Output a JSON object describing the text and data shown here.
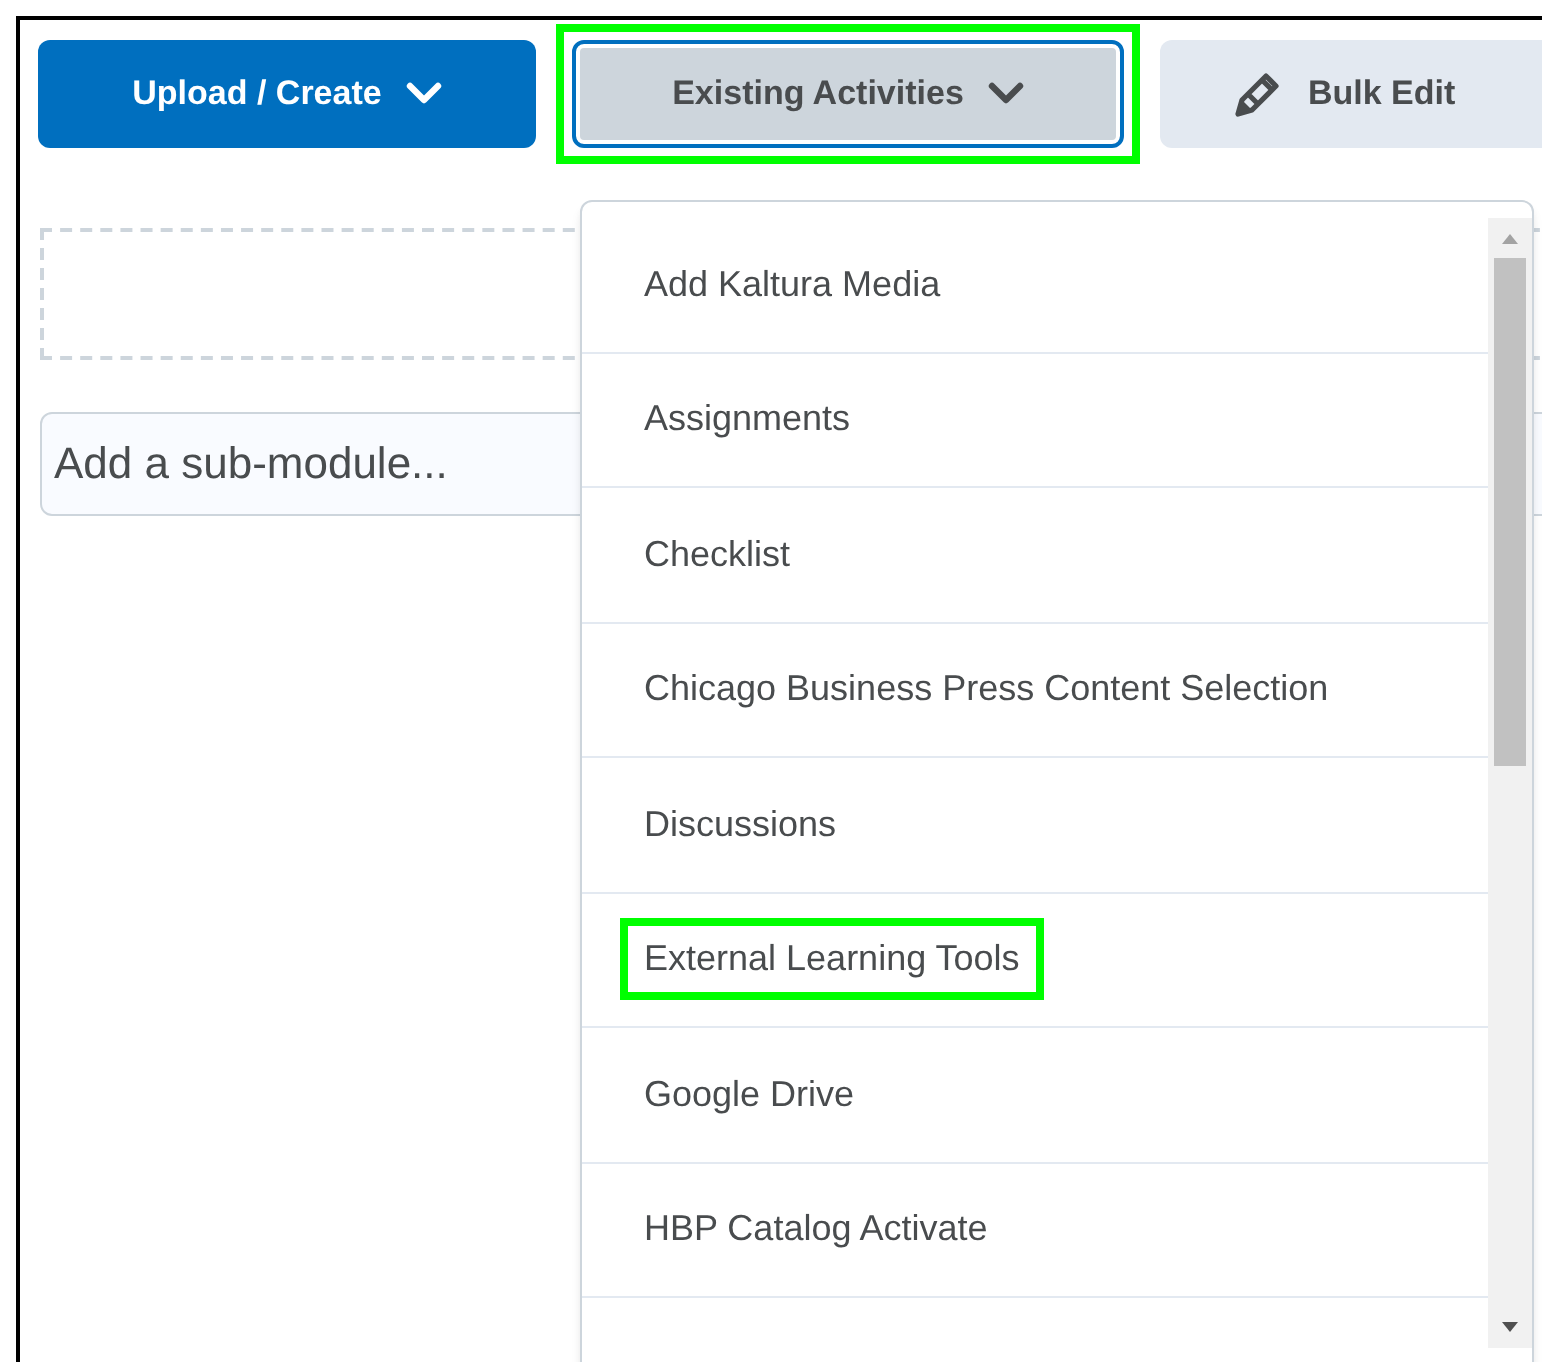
{
  "toolbar": [
    {
      "kind": "primary",
      "label": "Upload / Create",
      "expanded": false,
      "highlighted": false
    },
    {
      "kind": "dropdown",
      "label": "Existing Activities",
      "expanded": true,
      "highlighted": true
    },
    {
      "kind": "edit",
      "label": "Bulk Edit",
      "expanded": false,
      "highlighted": false
    }
  ],
  "submodule": {
    "placeholder": "Add a sub-module..."
  },
  "menu": {
    "items": [
      {
        "label": "Add Kaltura Media",
        "highlighted": false
      },
      {
        "label": "Assignments",
        "highlighted": false
      },
      {
        "label": "Checklist",
        "highlighted": false
      },
      {
        "label": "Chicago Business Press Content Selection",
        "highlighted": false
      },
      {
        "label": "Discussions",
        "highlighted": false
      },
      {
        "label": "External Learning Tools",
        "highlighted": true
      },
      {
        "label": "Google Drive",
        "highlighted": false
      },
      {
        "label": "HBP Catalog Activate",
        "highlighted": false
      }
    ]
  }
}
